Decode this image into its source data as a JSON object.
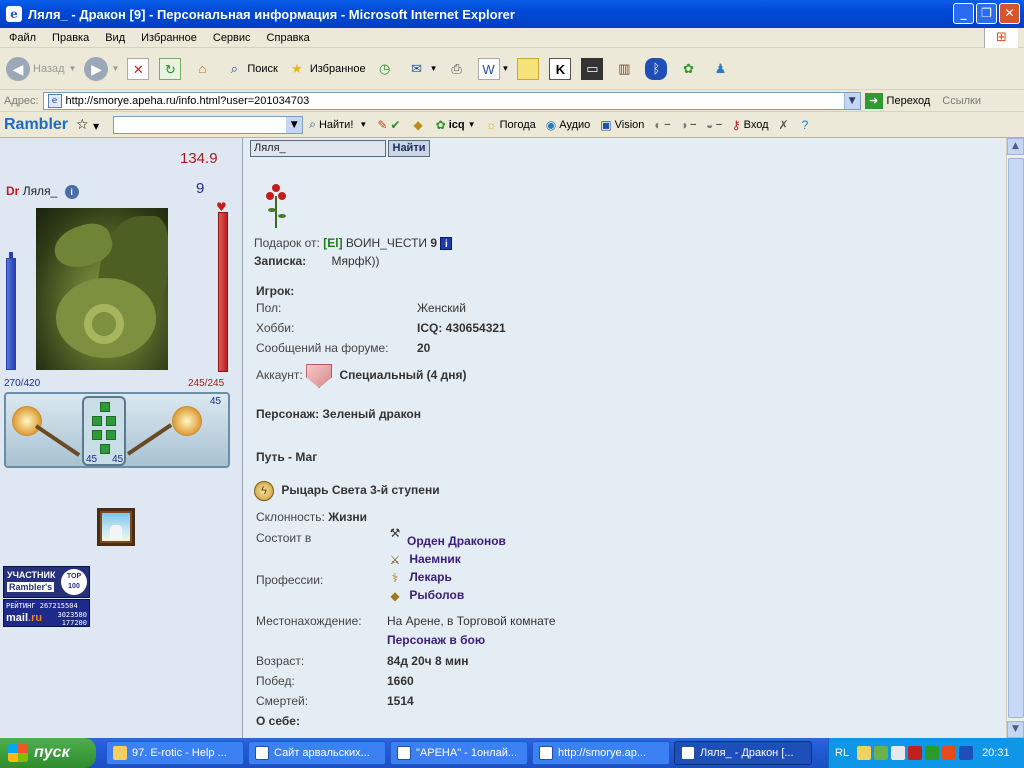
{
  "window": {
    "title": "Ляля_ - Дракон [9] - Персональная информация - Microsoft Internet Explorer",
    "min": "_",
    "max": "❐",
    "close": "✕"
  },
  "menu": [
    "Файл",
    "Правка",
    "Вид",
    "Избранное",
    "Сервис",
    "Справка"
  ],
  "toolbar": {
    "back": "Назад",
    "search": "Поиск",
    "favorites": "Избранное"
  },
  "address": {
    "label": "Адрес:",
    "url": "http://smorye.apeha.ru/info.html?user=201034703",
    "go": "Переход",
    "links": "Ссылки"
  },
  "rambler": {
    "logo": "Rambler",
    "find": "Найти!",
    "weather": "Погода",
    "audio": "Аудио",
    "vision": "Vision",
    "login": "Вход",
    "icq": "icq"
  },
  "left": {
    "hp_top": "134.9",
    "prefix": "Dr",
    "nick": "Ляля_",
    "level": "9",
    "mana": "270/420",
    "health": "245/245",
    "equip_top": "45",
    "equip_left": "45",
    "equip_right": "45",
    "badge_participant": "УЧАСТНИК",
    "badge_ramblers": "Rambler's",
    "badge_top": "TOP 100",
    "badge_rating": "РЕЙТИНГ",
    "badge_rating_num": "267215504",
    "badge_mail_num1": "3023580",
    "badge_mail_num2": "177200",
    "badge_mail_pre": "mail",
    "badge_mail_post": ".ru"
  },
  "main": {
    "msg_value": "Ляля_",
    "msg_button": "Найти",
    "gift_label": "Подарок от:",
    "gift_clan": "[El]",
    "gift_from": "ВОИН_ЧЕСТИ",
    "gift_level": "9",
    "note_label": "Записка:",
    "note_text": "МярфК))",
    "player_label": "Игрок:",
    "gender_label": "Пол:",
    "gender_value": "Женский",
    "hobby_label": "Хобби:",
    "hobby_value": "ICQ: 430654321",
    "posts_label": "Сообщений на форуме:",
    "posts_value": "20",
    "account_label": "Аккаунт:",
    "account_value": "Специальный (4 дня)",
    "character_label": "Персонаж:",
    "character_value": "Зеленый дракон",
    "path_label": "Путь",
    "path_value": "- Маг",
    "knight": "Рыцарь Света 3-й ступени",
    "align_label": "Склонность:",
    "align_value": "Жизни",
    "member_label": "Состоит в",
    "member_value": "Орден Драконов",
    "prof_label": "Профессии:",
    "professions": [
      "Наемник",
      "Лекарь",
      "Рыболов"
    ],
    "location_label": "Местонахождение:",
    "location_value": "На Арене, в Торговой комнате",
    "in_battle": "Персонаж в бою",
    "age_label": "Возраст:",
    "age_value": "84д 20ч 8 мин",
    "wins_label": "Побед:",
    "wins_value": "1660",
    "deaths_label": "Смертей:",
    "deaths_value": "1514",
    "about_label": "О себе:"
  },
  "taskbar": {
    "start": "пуск",
    "tasks": [
      "97. E-rotic - Help ...",
      "Сайт арвальских...",
      "\"АРЕНА\" - 1онлай...",
      "http://smorye.ap...",
      "Ляля_ - Дракон [..."
    ],
    "lang": "RL",
    "clock": "20:31"
  },
  "colors": {
    "title_bar": "#0049d6",
    "chrome": "#ece9d8",
    "content_bg": "#e5edf4",
    "link": "#3a1e7a",
    "clan_green": "#1f7a1f"
  }
}
